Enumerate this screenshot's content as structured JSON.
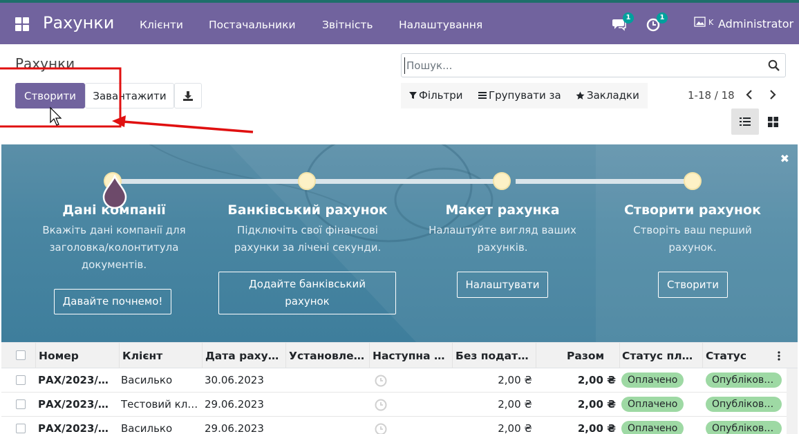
{
  "navbar": {
    "brand": "Рахунки",
    "menu": [
      "Клієнти",
      "Постачальники",
      "Звітність",
      "Налаштування"
    ],
    "messages_count": "1",
    "activities_count": "1",
    "avatar_alt": "K",
    "user": "Administrator",
    "color": "#71639e"
  },
  "control": {
    "title": "Рахунки",
    "create": "Створити",
    "upload": "Завантажити",
    "search_placeholder": "Пошук...",
    "filters": "Фільтри",
    "group_by": "Групувати за",
    "favorites": "Закладки",
    "pager": "1-18 / 18"
  },
  "onboarding": {
    "steps": [
      {
        "title": "Дані компанії",
        "desc": [
          "Вкажіть дані компанії для",
          "заголовка/колонтитула",
          "документів."
        ],
        "button": "Давайте почнемо!"
      },
      {
        "title": "Банківський рахунок",
        "desc": [
          "Підключіть свої фінансові",
          "рахунки за лічені секунди."
        ],
        "button": [
          "Додайте банківський",
          "рахунок"
        ]
      },
      {
        "title": "Макет рахунка",
        "desc": [
          "Налаштуйте вигляд ваших",
          "рахунків."
        ],
        "button": "Налаштувати"
      },
      {
        "title": "Створити рахунок",
        "desc": [
          "Створіть ваш перший",
          "рахунок."
        ],
        "button": "Створити"
      }
    ]
  },
  "table": {
    "columns": [
      "Номер",
      "Клієнт",
      "Дата раху…",
      "Установле…",
      "Наступна дія",
      "Без податк…",
      "Разом",
      "Статус пла…",
      "Статус"
    ],
    "rows": [
      {
        "number": "РАХ/2023/00…",
        "client": "Василько",
        "date": "30.06.2023",
        "untaxed": "2,00 ₴",
        "total": "2,00 ₴",
        "payment": "Оплачено",
        "status": "Опублікова…"
      },
      {
        "number": "РАХ/2023/00…",
        "client": "Тестовий кл…",
        "date": "29.06.2023",
        "untaxed": "2,00 ₴",
        "total": "2,00 ₴",
        "payment": "Оплачено",
        "status": "Опублікова…"
      },
      {
        "number": "РАХ/2023/00…",
        "client": "Василько",
        "date": "29.06.2023",
        "untaxed": "2,00 ₴",
        "total": "2,00 ₴",
        "payment": "Оплачено",
        "status": "Опублікова…"
      }
    ]
  },
  "colors": {
    "primary": "#71639e",
    "annotation": "#e01010",
    "paid_badge": "#9ed9a4"
  }
}
